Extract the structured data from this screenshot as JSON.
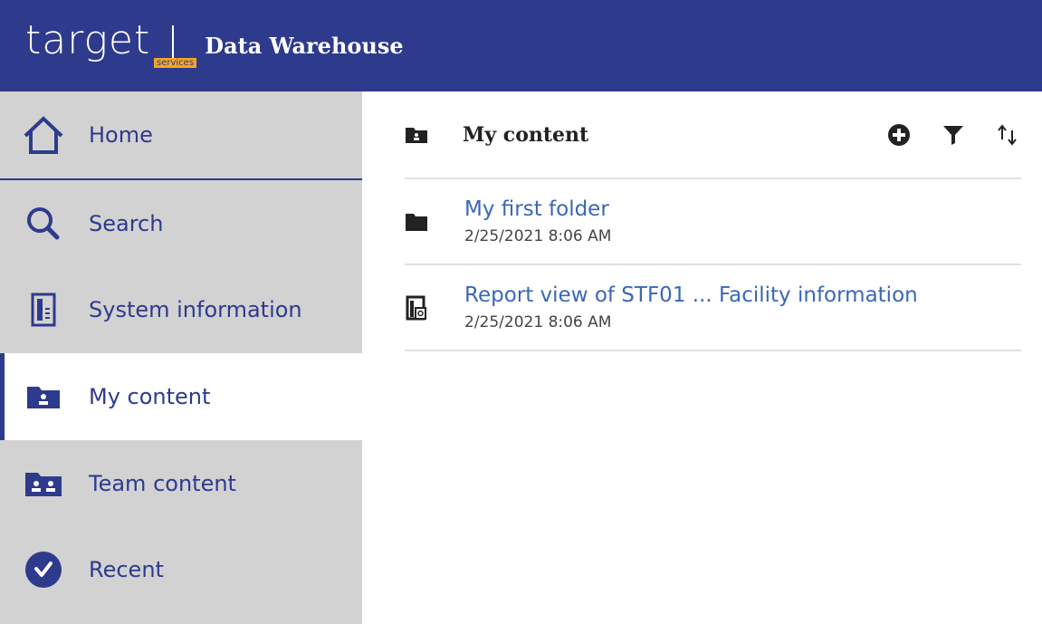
{
  "header": {
    "logo_text": "target",
    "logo_subtext": "services",
    "title": "Data Warehouse"
  },
  "colors": {
    "brand": "#2e3a8c",
    "accent": "#f5a623",
    "link": "#3a67b8",
    "sidebar_bg": "#d2d2d2"
  },
  "sidebar": {
    "items": [
      {
        "label": "Home",
        "icon": "home-icon"
      },
      {
        "label": "Search",
        "icon": "search-icon"
      },
      {
        "label": "System information",
        "icon": "system-info-icon"
      },
      {
        "label": "My content",
        "icon": "my-content-icon",
        "active": true
      },
      {
        "label": "Team content",
        "icon": "team-content-icon"
      },
      {
        "label": "Recent",
        "icon": "recent-icon"
      }
    ]
  },
  "main": {
    "title": "My content",
    "toolbar": {
      "add_icon": "add-circle-icon",
      "filter_icon": "filter-icon",
      "sort_icon": "sort-icon"
    },
    "items": [
      {
        "name": "My first folder",
        "date": "2/25/2021 8:06 AM",
        "icon": "folder-icon"
      },
      {
        "name": "Report view of STF01 ... Facility information",
        "date": "2/25/2021 8:06 AM",
        "icon": "report-view-icon"
      }
    ]
  }
}
